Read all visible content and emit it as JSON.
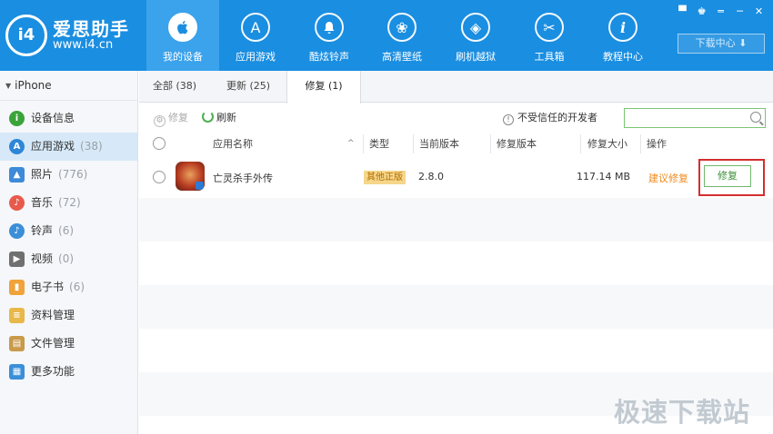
{
  "logo": {
    "mark": "i4",
    "name": "爱思助手",
    "url": "www.i4.cn"
  },
  "nav": [
    {
      "label": "我的设备",
      "icon": "apple-icon",
      "glyph": ""
    },
    {
      "label": "应用游戏",
      "icon": "app-store-icon",
      "glyph": "A"
    },
    {
      "label": "酷炫铃声",
      "icon": "bell-icon",
      "glyph": "🔔"
    },
    {
      "label": "高清壁纸",
      "icon": "flower-icon",
      "glyph": "❀"
    },
    {
      "label": "刷机越狱",
      "icon": "dropbox-icon",
      "glyph": "◈"
    },
    {
      "label": "工具箱",
      "icon": "tools-icon",
      "glyph": "✂"
    },
    {
      "label": "教程中心",
      "icon": "info-icon",
      "glyph": "i"
    }
  ],
  "window": {
    "controls": [
      "▀",
      "♚",
      "═",
      "─",
      "✕"
    ],
    "download_center": "下载中心 ⬇"
  },
  "sidebar": {
    "device": "iPhone",
    "items": [
      {
        "label": "设备信息",
        "count": "",
        "icon": "info-icon",
        "color": "#3aa33a",
        "glyph": "i"
      },
      {
        "label": "应用游戏",
        "count": "(38)",
        "icon": "app-store-icon",
        "color": "#2f86d6",
        "glyph": "A"
      },
      {
        "label": "照片",
        "count": "(776)",
        "icon": "photo-icon",
        "color": "#3c8ad8",
        "glyph": "▲"
      },
      {
        "label": "音乐",
        "count": "(72)",
        "icon": "music-icon",
        "color": "#e85a4a",
        "glyph": "♪"
      },
      {
        "label": "铃声",
        "count": "(6)",
        "icon": "bell-icon",
        "color": "#3a8fd8",
        "glyph": "♪"
      },
      {
        "label": "视频",
        "count": "(0)",
        "icon": "video-icon",
        "color": "#707070",
        "glyph": "▶"
      },
      {
        "label": "电子书",
        "count": "(6)",
        "icon": "book-icon",
        "color": "#f0a33a",
        "glyph": "▮"
      },
      {
        "label": "资料管理",
        "count": "",
        "icon": "contacts-icon",
        "color": "#e8b84a",
        "glyph": "≡"
      },
      {
        "label": "文件管理",
        "count": "",
        "icon": "file-icon",
        "color": "#c89a4a",
        "glyph": "▤"
      },
      {
        "label": "更多功能",
        "count": "",
        "icon": "more-icon",
        "color": "#3a8fd8",
        "glyph": "▦"
      }
    ]
  },
  "tabs": [
    {
      "label": "全部 (38)"
    },
    {
      "label": "更新 (25)"
    },
    {
      "label": "修复 (1)"
    }
  ],
  "toolbar": {
    "repair": "修复",
    "refresh": "刷新",
    "untrusted": "不受信任的开发者",
    "search_placeholder": ""
  },
  "table": {
    "headers": {
      "name": "应用名称",
      "type": "类型",
      "current": "当前版本",
      "repair_version": "修复版本",
      "size": "修复大小",
      "action": "操作"
    },
    "rows": [
      {
        "name": "亡灵杀手外传",
        "type": "其他正版",
        "current": "2.8.0",
        "repair_version": "",
        "size": "117.14 MB",
        "suggest": "建议修复",
        "button": "修复"
      }
    ]
  },
  "watermark": "极速下载站"
}
